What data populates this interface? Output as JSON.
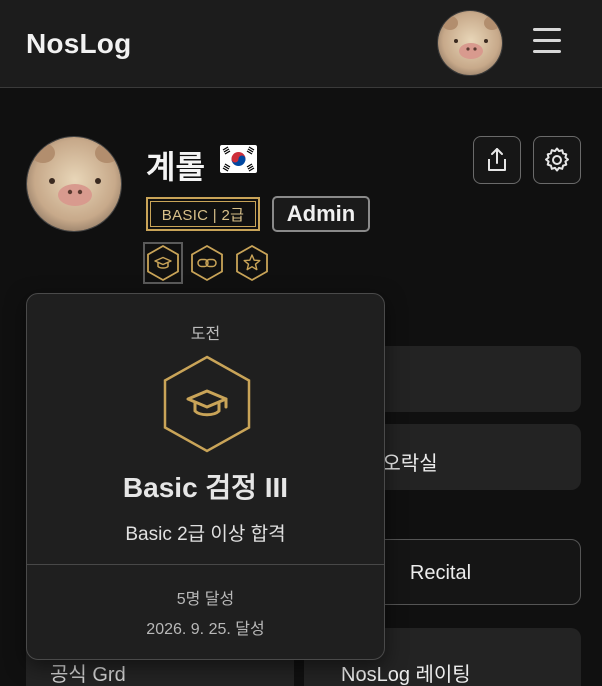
{
  "header": {
    "logo": "NosLog"
  },
  "profile": {
    "username": "계롤",
    "level_badge": "BASIC | 2급",
    "role_badge": "Admin"
  },
  "cards": {
    "card_2_text": "구오락실",
    "card_3_text": "Recital",
    "card_4_text": "공식 Grd",
    "card_5_text": "NosLog 레이팅"
  },
  "popover": {
    "category": "도전",
    "title": "Basic 검정 III",
    "description": "Basic 2급 이상 합격",
    "achieved_count": "5명 달성",
    "achieved_date": "2026. 9. 25. 달성"
  },
  "colors": {
    "accent_gold": "#c9a458",
    "background": "#101010",
    "card": "#232323"
  },
  "icons": {
    "achievement_1": "graduation-cap-icon",
    "achievement_2": "link-icon",
    "achievement_3": "star-icon",
    "share": "share-icon",
    "settings": "gear-icon",
    "menu": "hamburger-icon"
  }
}
